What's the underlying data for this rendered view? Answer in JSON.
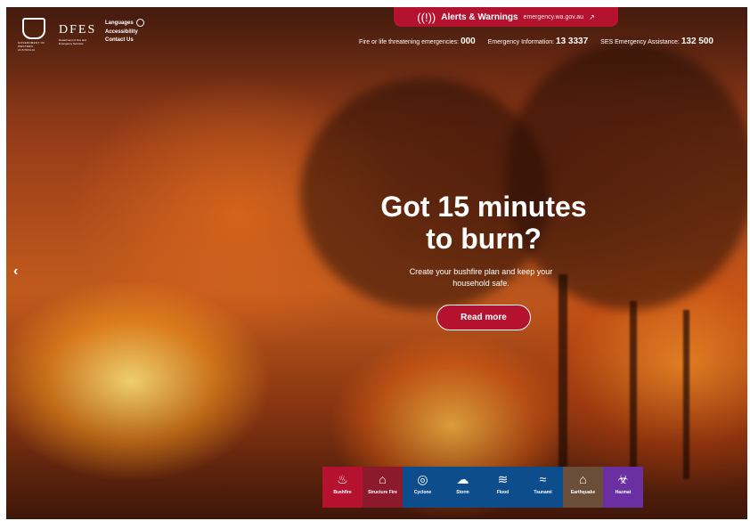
{
  "alert_bar": {
    "title": "Alerts & Warnings",
    "link": "emergency.wa.gov.au",
    "icon": "alert-signal-icon",
    "ext_icon": "↗"
  },
  "header": {
    "gov_logo_text": "GOVERNMENT OF WESTERN AUSTRALIA",
    "dfes_logo": "DFES",
    "dfes_sub": "Department of Fire and Emergency Services",
    "util_links": {
      "languages": "Languages",
      "accessibility": "Accessibility",
      "contact": "Contact Us"
    },
    "contacts": [
      {
        "label": "Fire or life threatening emergencies:",
        "number": "000"
      },
      {
        "label": "Emergency Information:",
        "number": "13 3337"
      },
      {
        "label": "SES Emergency Assistance:",
        "number": "132 500"
      }
    ]
  },
  "hero": {
    "headline_line1": "Got 15 minutes",
    "headline_line2": "to burn?",
    "subtext_line1": "Create your bushfire plan and keep your",
    "subtext_line2": "household safe.",
    "cta": "Read more",
    "prev_arrow": "‹"
  },
  "hazards": [
    {
      "label": "Bushfire",
      "icon": "flame-icon",
      "glyph": "♨",
      "color": "#b4122f"
    },
    {
      "label": "Structure Fire",
      "icon": "house-fire-icon",
      "glyph": "⌂",
      "color": "#8d1a2c"
    },
    {
      "label": "Cyclone",
      "icon": "cyclone-icon",
      "glyph": "◎",
      "color": "#0e4d8c"
    },
    {
      "label": "Storm",
      "icon": "storm-cloud-icon",
      "glyph": "☁",
      "color": "#0e4d8c"
    },
    {
      "label": "Flood",
      "icon": "flood-waves-icon",
      "glyph": "≋",
      "color": "#0e4d8c"
    },
    {
      "label": "Tsunami",
      "icon": "tsunami-wave-icon",
      "glyph": "≈",
      "color": "#0e4d8c"
    },
    {
      "label": "Earthquake",
      "icon": "earthquake-icon",
      "glyph": "⌂",
      "color": "#6b4e3a"
    },
    {
      "label": "Hazmat",
      "icon": "hazmat-icon",
      "glyph": "☣",
      "color": "#6a2fa0"
    }
  ]
}
